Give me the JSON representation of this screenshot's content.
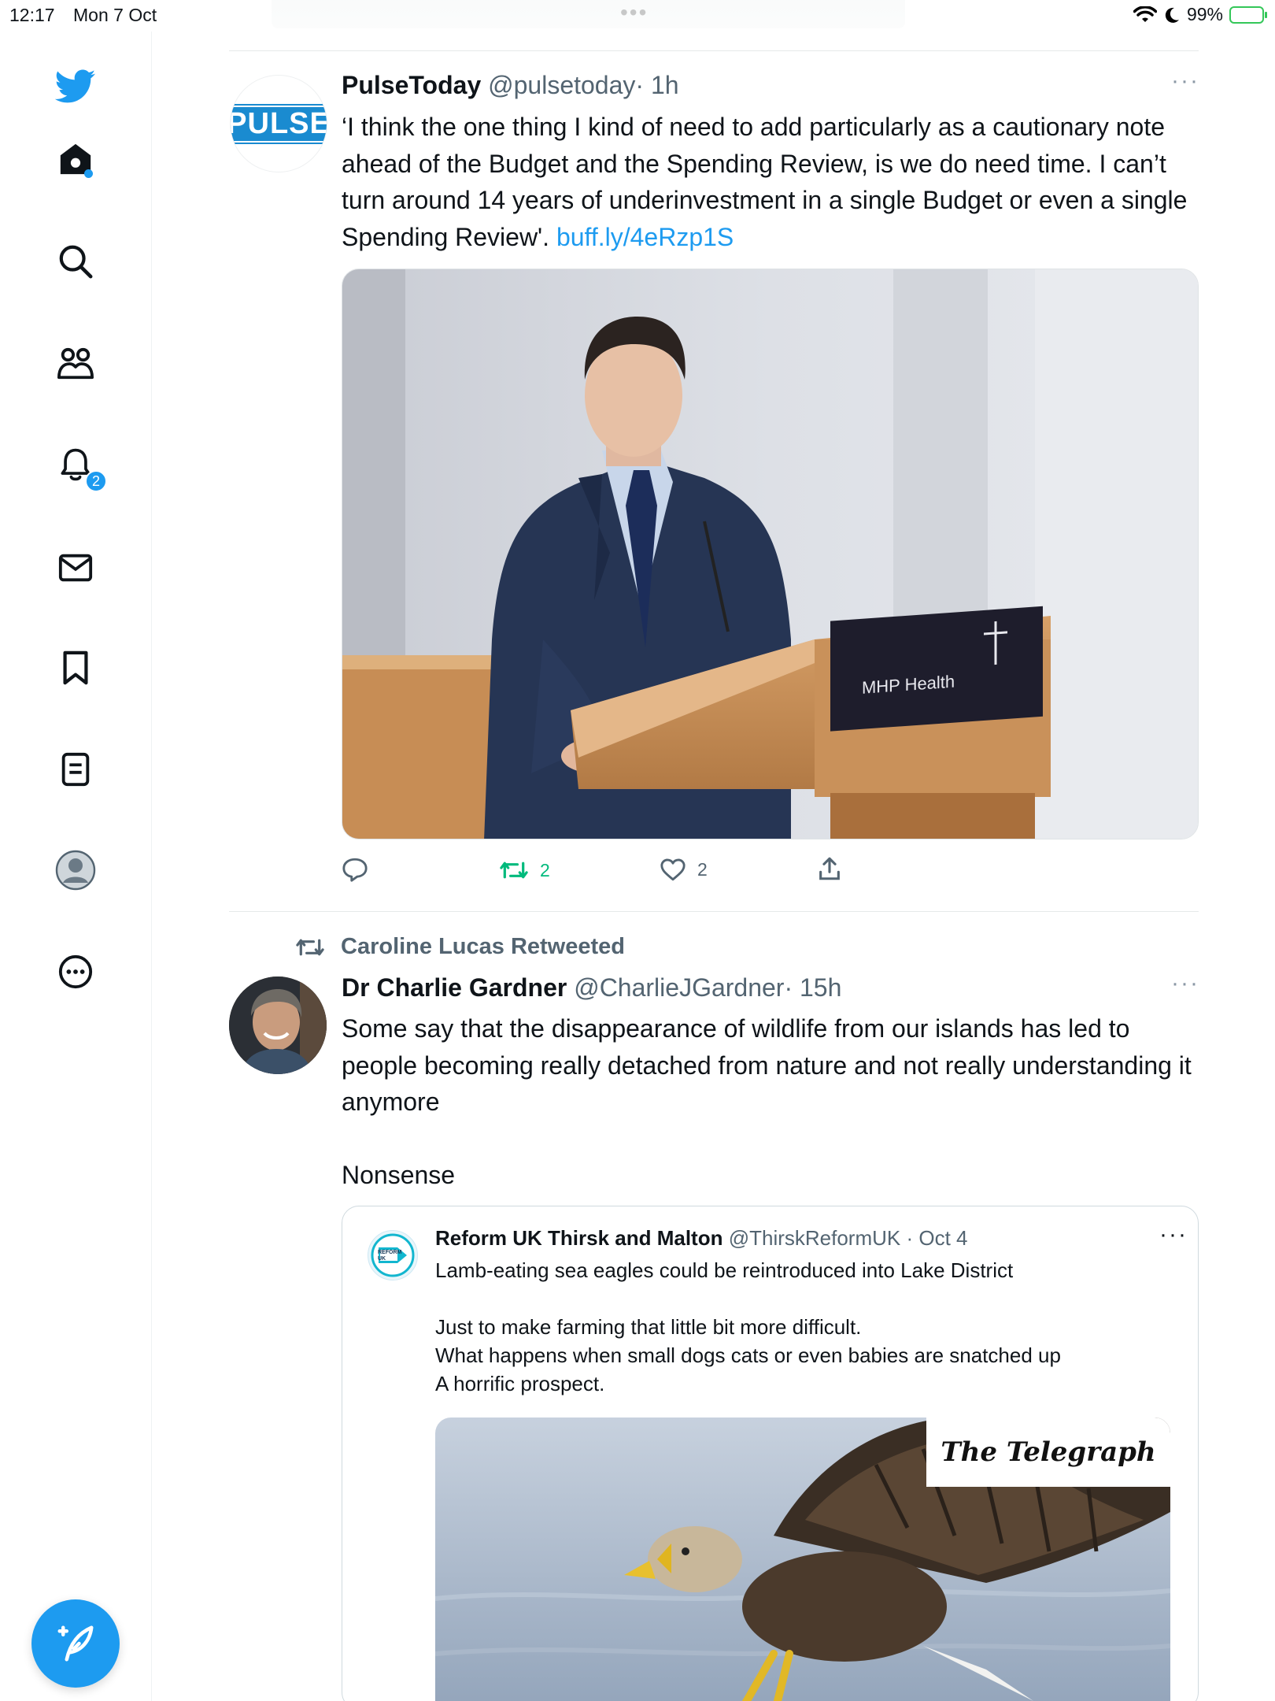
{
  "status_bar": {
    "time": "12:17",
    "date": "Mon 7 Oct",
    "battery": "99%"
  },
  "sidebar": {
    "notifications_badge": "2",
    "icons": [
      "twitter-bird-icon",
      "home-icon",
      "search-icon",
      "communities-icon",
      "notifications-icon",
      "messages-icon",
      "bookmark-icon",
      "lists-icon",
      "profile-icon",
      "more-icon",
      "compose-icon"
    ]
  },
  "tweets": [
    {
      "name": "PulseToday",
      "handle": "@pulsetoday",
      "time": "· 1h",
      "avatar_text": "PULSE",
      "text": "‘I think the one thing I kind of need to add particularly as a cautionary note ahead of the Budget and the Spending Review, is we do need time. I can’t turn around 14 years of underinvestment in a single Budget or even a single Spending Review'.",
      "link": "buff.ly/4eRzp1S",
      "media_sign_text": "MHP Health",
      "retweets": "2",
      "likes": "2"
    },
    {
      "retweeted_by": "Caroline Lucas Retweeted",
      "name": "Dr Charlie Gardner",
      "handle": "@CharlieJGardner",
      "time": "· 15h",
      "text_1": "Some say that the disappearance of wildlife from our islands has led to people becoming really detached from nature and not really understanding it anymore",
      "text_2": "Nonsense",
      "quote": {
        "name": "Reform UK Thirsk and Malton",
        "handle": "@ThirskReformUK",
        "time": "· Oct 4",
        "avatar_text": "REFORM UK",
        "line_1": "Lamb-eating sea eagles could be reintroduced into Lake District",
        "line_2": "Just to make farming that little bit more difficult.",
        "line_3": "What happens when small dogs cats or even babies are snatched up",
        "line_4": "A horrific prospect.",
        "media_label": "The Telegraph"
      }
    }
  ],
  "colors": {
    "accent": "#1d9bf0",
    "retweet_green": "#00ba7c",
    "secondary_text": "#536471"
  }
}
